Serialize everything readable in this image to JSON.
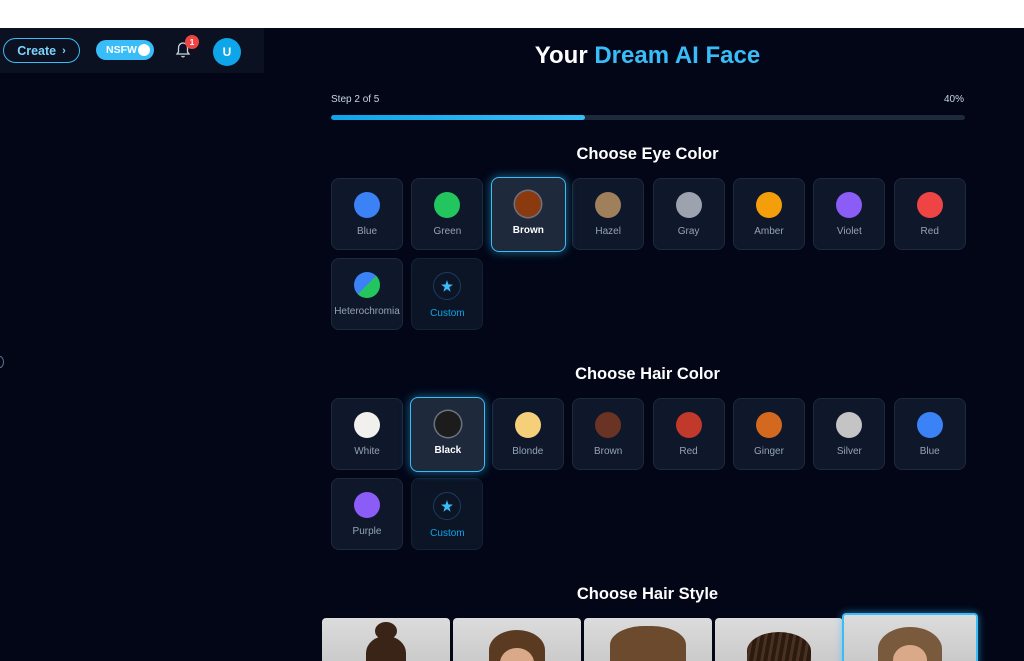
{
  "header": {
    "create_label": "Create",
    "nsfw_label": "NSFW",
    "notification_count": "1",
    "avatar_initial": "U"
  },
  "title": {
    "prefix": "Your",
    "accent": "Dream AI Face"
  },
  "progress": {
    "step_text": "Step 2 of 5",
    "percent_text": "40%",
    "value": 0.4
  },
  "eye_color": {
    "heading": "Choose Eye Color",
    "options": [
      {
        "label": "Blue",
        "color": "#3b82f6"
      },
      {
        "label": "Green",
        "color": "#22c55e"
      },
      {
        "label": "Brown",
        "color": "#8b3a0f",
        "selected": true
      },
      {
        "label": "Hazel",
        "color": "#a0805a"
      },
      {
        "label": "Gray",
        "color": "#9ca3af"
      },
      {
        "label": "Amber",
        "color": "#f59e0b"
      },
      {
        "label": "Violet",
        "color": "#8b5cf6"
      },
      {
        "label": "Red",
        "color": "#ef4444"
      },
      {
        "label": "Heterochromia",
        "color": "split:#3b82f6:#22c55e"
      },
      {
        "label": "Custom",
        "color": "custom"
      }
    ]
  },
  "hair_color": {
    "heading": "Choose Hair Color",
    "options": [
      {
        "label": "White",
        "color": "#f1f0ec"
      },
      {
        "label": "Black",
        "color": "#1c1c1c",
        "selected": true
      },
      {
        "label": "Blonde",
        "color": "#f6cf7a"
      },
      {
        "label": "Brown",
        "color": "#6b3323"
      },
      {
        "label": "Red",
        "color": "#c0392b"
      },
      {
        "label": "Ginger",
        "color": "#d2691e"
      },
      {
        "label": "Silver",
        "color": "#c4c4c4"
      },
      {
        "label": "Blue",
        "color": "#3b82f6"
      },
      {
        "label": "Purple",
        "color": "#8b5cf6"
      },
      {
        "label": "Custom",
        "color": "custom"
      }
    ]
  },
  "hair_style": {
    "heading": "Choose Hair Style",
    "cards": [
      {
        "style": "bun",
        "hair": "#3a2418",
        "selected": false
      },
      {
        "style": "ponytail",
        "hair": "#5a3b22",
        "selected": false
      },
      {
        "style": "curly",
        "hair": "#6b4a2e",
        "selected": false
      },
      {
        "style": "braids",
        "hair": "#2b1a10",
        "selected": false
      },
      {
        "style": "wavy",
        "hair": "#7a5a3c",
        "selected": true
      }
    ]
  }
}
